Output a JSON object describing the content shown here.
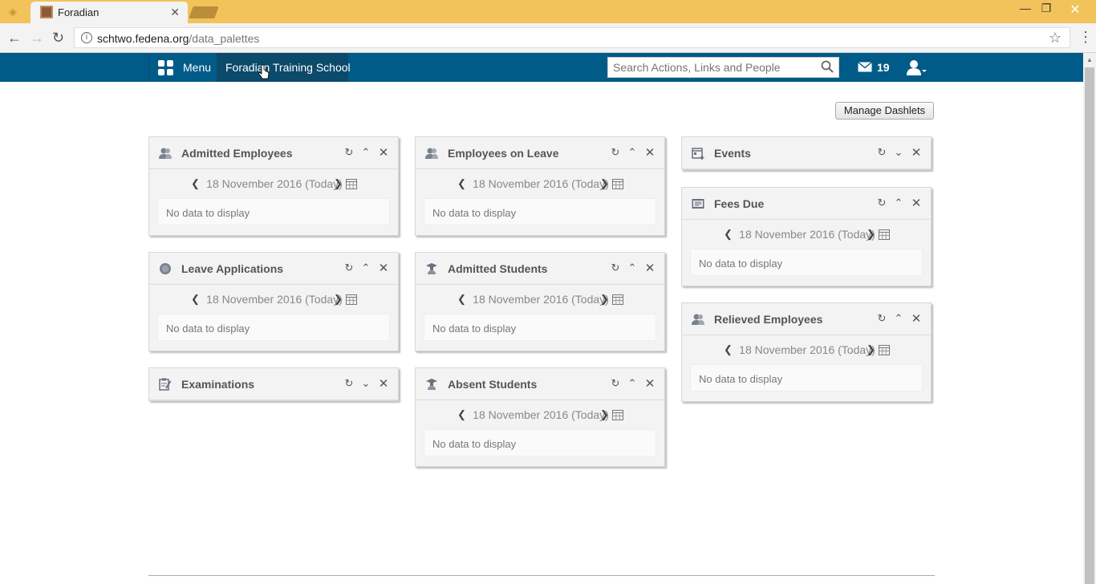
{
  "browser": {
    "tab_title": "Foradian",
    "url_host": "schtwo.fedena.org",
    "url_path": "/data_palettes"
  },
  "header": {
    "menu_label": "Menu",
    "school_name": "Foradian Training School",
    "search_placeholder": "Search Actions, Links and People",
    "message_count": "19"
  },
  "main": {
    "manage_label": "Manage Dashlets",
    "dashlets": [
      {
        "title": "Admitted Employees",
        "date": "18 November 2016 (Today)",
        "empty": "No data to display",
        "icon": "employees-icon"
      },
      {
        "title": "Employees on Leave",
        "date": "18 November 2016 (Today)",
        "empty": "No data to display",
        "icon": "employees-icon"
      },
      {
        "title": "Events",
        "icon": "events-icon"
      },
      {
        "title": "Fees Due",
        "date": "18 November 2016 (Today)",
        "empty": "No data to display",
        "icon": "fees-icon"
      },
      {
        "title": "Leave Applications",
        "date": "18 November 2016 (Today)",
        "empty": "No data to display",
        "icon": "leave-icon"
      },
      {
        "title": "Admitted Students",
        "date": "18 November 2016 (Today)",
        "empty": "No data to display",
        "icon": "student-icon"
      },
      {
        "title": "Relieved Employees",
        "date": "18 November 2016 (Today)",
        "empty": "No data to display",
        "icon": "employees-icon"
      },
      {
        "title": "Examinations",
        "icon": "exam-icon"
      },
      {
        "title": "Absent Students",
        "date": "18 November 2016 (Today)",
        "empty": "No data to display",
        "icon": "student-icon"
      }
    ]
  },
  "colors": {
    "titlebar": "#f1c35a",
    "appbar": "#005b88",
    "school_active": "#0b4a6b"
  }
}
